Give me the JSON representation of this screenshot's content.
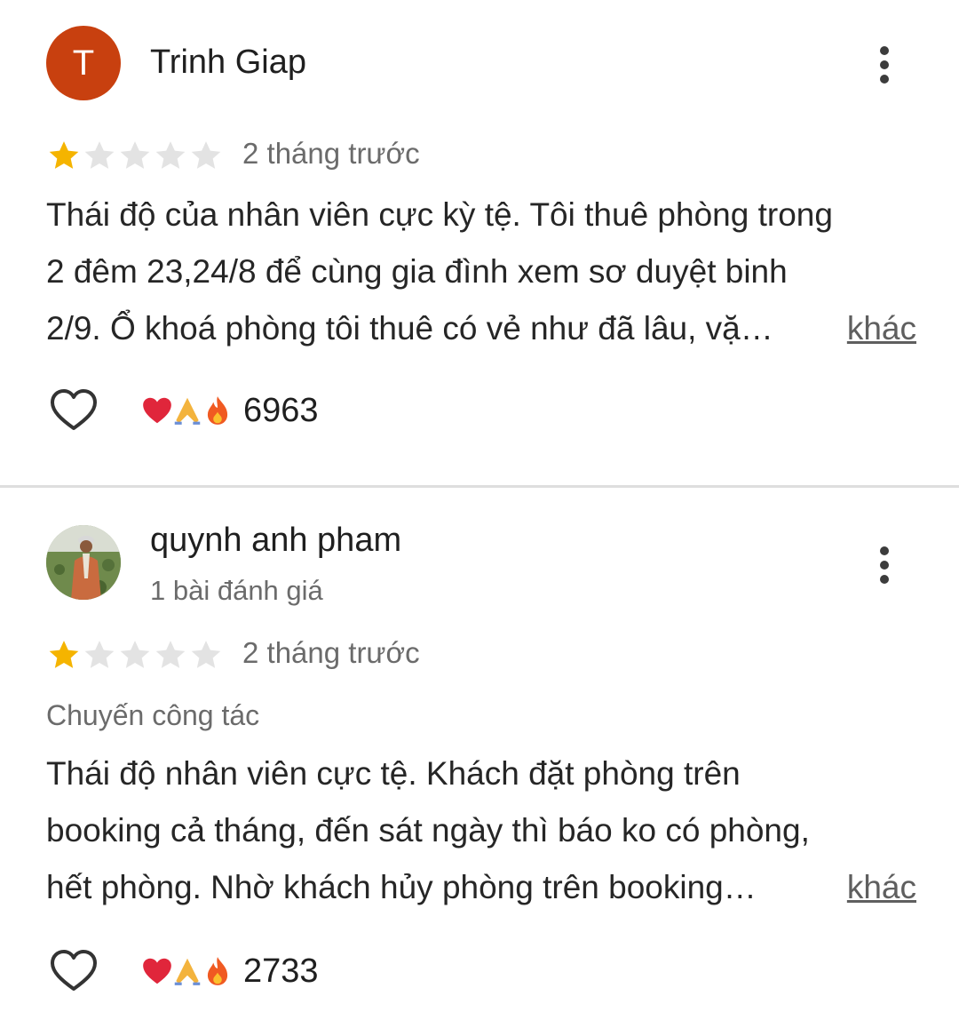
{
  "reviews": [
    {
      "author": "Trinh Giap",
      "avatar_letter": "T",
      "rating": 1,
      "rating_max": 5,
      "time": "2 tháng trước",
      "lines": [
        "Thái độ của nhân viên cực kỳ tệ. Tôi thuê phòng trong",
        "2 đêm 23,24/8 để cùng gia đình xem sơ duyệt binh",
        "2/9. Ổ khoá phòng tôi thuê có vẻ như đã lâu, vặ…"
      ],
      "more_label": "khác",
      "reaction_count": "6963"
    },
    {
      "author": "quynh anh pham",
      "author_subinfo": "1 bài đánh giá",
      "rating": 1,
      "rating_max": 5,
      "time": "2 tháng trước",
      "trip_type": "Chuyến công tác",
      "lines": [
        "Thái độ nhân viên cực tệ. Khách đặt phòng trên",
        "booking cả tháng, đến sát ngày thì báo ko có phòng,",
        "hết phòng. Nhờ khách hủy phòng trên booking…"
      ],
      "more_label": "khác",
      "reaction_count": "2733"
    }
  ],
  "icons": {
    "more": "more-vert-icon",
    "like": "heart-outline-icon",
    "reactions": [
      "red-heart-emoji",
      "folded-hands-emoji",
      "fire-emoji"
    ]
  },
  "colors": {
    "star_filled": "#f5b400",
    "star_empty": "#e3e3e3",
    "avatar_bg": "#c8400f",
    "divider": "#dedede"
  }
}
